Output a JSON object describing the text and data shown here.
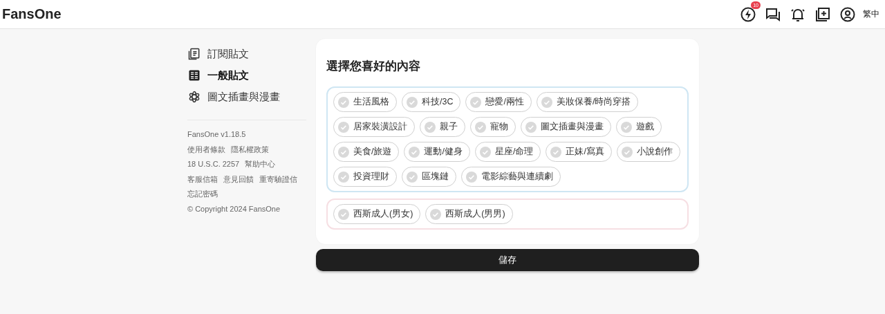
{
  "header": {
    "logo": "FansOne",
    "notification_count": "10",
    "language": "繁中"
  },
  "sidebar": {
    "items": [
      {
        "label": "訂閱貼文",
        "kind": "document",
        "selected": false
      },
      {
        "label": "一般貼文",
        "kind": "grid",
        "selected": true
      },
      {
        "label": "圖文插畫與漫畫",
        "kind": "flower",
        "selected": false
      }
    ],
    "footer_lines": [
      [
        "FansOne v1.18.5"
      ],
      [
        "使用者條款",
        "隱私權政策"
      ],
      [
        "18 U.S.C. 2257",
        "幫助中心"
      ],
      [
        "客服信箱",
        "意見回饋",
        "重寄驗證信"
      ],
      [
        "忘記密碼"
      ],
      [
        "© Copyright 2024 FansOne"
      ]
    ]
  },
  "preferences": {
    "title": "選擇您喜好的內容",
    "groups": [
      {
        "color": "#cfe6f3",
        "tags": [
          {
            "label": "生活風格",
            "selected": false
          },
          {
            "label": "科技/3C",
            "selected": false
          },
          {
            "label": "戀愛/兩性",
            "selected": false
          },
          {
            "label": "美妝保養/時尚穿搭",
            "selected": false
          },
          {
            "label": "居家裝潢設計",
            "selected": false
          },
          {
            "label": "親子",
            "selected": false
          },
          {
            "label": "寵物",
            "selected": false
          },
          {
            "label": "圖文插畫與漫畫",
            "selected": false
          },
          {
            "label": "遊戲",
            "selected": false
          },
          {
            "label": "美食/旅遊",
            "selected": false
          },
          {
            "label": "運動/健身",
            "selected": false
          },
          {
            "label": "星座/命理",
            "selected": false
          },
          {
            "label": "正妹/寫真",
            "selected": false
          },
          {
            "label": "小說創作",
            "selected": false
          },
          {
            "label": "投資理財",
            "selected": false
          },
          {
            "label": "區塊鏈",
            "selected": false
          },
          {
            "label": "電影綜藝與連續劇",
            "selected": false
          }
        ]
      },
      {
        "color": "#f6dfe3",
        "tags": [
          {
            "label": "西斯成人(男女)",
            "selected": false
          },
          {
            "label": "西斯成人(男男)",
            "selected": false
          }
        ]
      }
    ],
    "save_button": "儲存"
  }
}
